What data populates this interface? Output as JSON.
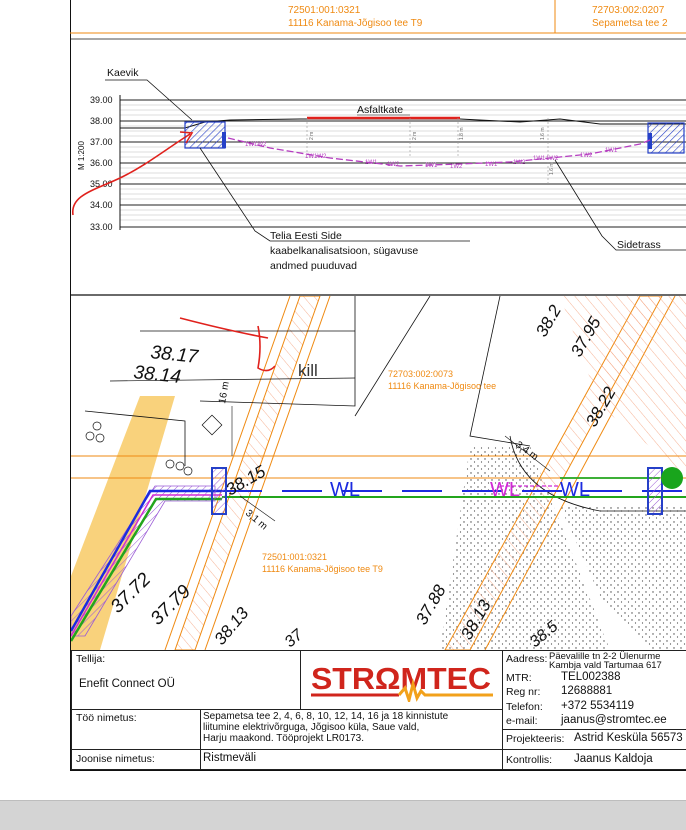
{
  "top_strip": {
    "parcel_left_id": "72501:001:0321",
    "parcel_left_name": "11116 Kanama-Jõgisoo tee T9",
    "parcel_right_id": "72703:002:0207",
    "parcel_right_name": "Sepametsa tee 2"
  },
  "profile": {
    "kaevik_label": "Kaevik",
    "asfalt_label": "Asfaltkate",
    "scale_label": "M 1:200",
    "y_ticks": [
      "39.00",
      "38.00",
      "37.00",
      "36.00",
      "35.00",
      "34.00",
      "33.00"
    ],
    "telia_title": "Telia Eesti Side",
    "telia_line2": "kaabelkanalisatsioon, sügavuse",
    "telia_line3": "andmed puuduvad",
    "sidetrass_label": "Sidetrass",
    "depth_labels": [
      "2 m",
      "2 m",
      "1.8 m",
      "1.6 m",
      "1.6 m"
    ],
    "cable_labels": [
      "1W1W2",
      "1W1W2",
      "1W1",
      "1W2",
      "1W1",
      "1W2",
      "1W1",
      "1W2",
      "1W1",
      "1W2",
      "1W2",
      "1W1"
    ],
    "colors": {
      "cable": "#b53cc0",
      "asphalt": "#e0211c",
      "handwriting": "#e0211c",
      "hatch": "#2540c8"
    }
  },
  "plan": {
    "elev_3817": "38.17",
    "elev_3814": "38.14",
    "elev_3815": "38.15",
    "elev_3772": "37.72",
    "elev_3779": "37.79",
    "elev_3813a": "38.13",
    "elev_3788": "37.88",
    "elev_3813b": "38.13",
    "elev_3822": "38.22",
    "elev_3795": "37.95",
    "elev_382": "38.2",
    "elev_385": "38.5",
    "elev_37": "37",
    "dim_16m": "16 m",
    "dim_31m": "3,1 m",
    "dim_34m": "3,4 m",
    "handwritten_kill": "kill",
    "parcel_mid_id": "72703:002:0073",
    "parcel_mid_name": "11116 Kanama-Jõgisoo tee",
    "parcel_low_id": "72501:001:0321",
    "parcel_low_name": "11116 Kanama-Jõgisoo tee T9",
    "cable_label_a": "WL",
    "cable_label_b": "WL",
    "cable_label_c": "WL"
  },
  "title_block": {
    "tellija_label": "Tellija:",
    "tellija_value": "Enefit Connect OÜ",
    "logo_text": "STRΩMTEC",
    "aadress_label": "Aadress:",
    "aadress_line1": "Päevalille tn 2-2 Ülenurme",
    "aadress_line2": "Kambja vald Tartumaa 617",
    "mtr_label": "MTR:",
    "mtr_value": "TEL002388",
    "regnr_label": "Reg nr:",
    "regnr_value": "12688881",
    "telefon_label": "Telefon:",
    "telefon_value": "+372 5534119",
    "email_label": "e-mail:",
    "email_value": "jaanus@stromtec.ee",
    "too_nimetus_label": "Töö nimetus:",
    "too_nimetus_line1": "Sepametsa tee 2, 4, 6, 8, 10, 12, 14, 16 ja 18 kinnistute",
    "too_nimetus_line2": "liitumine elektrivõrguga, Jõgisoo küla, Saue vald,",
    "too_nimetus_line3": "Harju maakond. Tööprojekt LR0173.",
    "projekteeris_label": "Projekteeris:",
    "projekteeris_value": "Astrid Kesküla 56573",
    "joonise_label": "Joonise nimetus:",
    "joonise_value": "Ristmeväli",
    "kontrollis_label": "Kontrollis:",
    "kontrollis_value": "Jaanus Kaldoja"
  }
}
